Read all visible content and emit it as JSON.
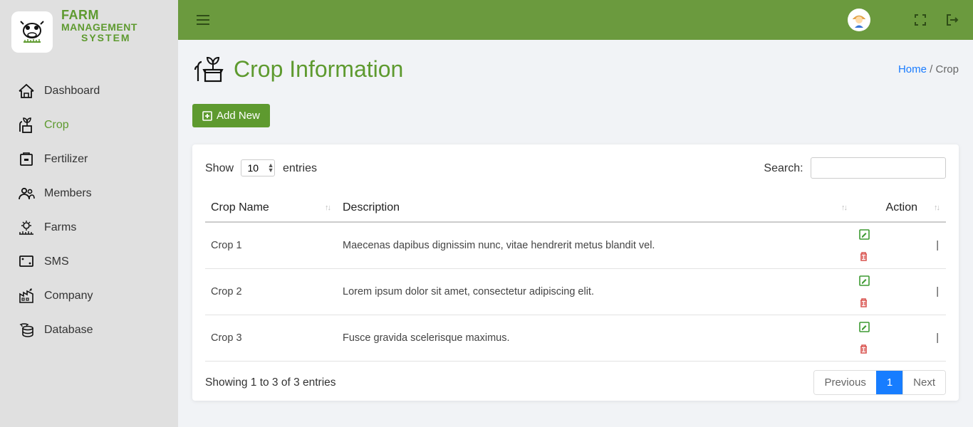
{
  "brand": {
    "line1": "FARM",
    "line2": "MANAGEMENT",
    "line3": "SYSTEM"
  },
  "sidebar": {
    "items": [
      {
        "label": "Dashboard",
        "active": false
      },
      {
        "label": "Crop",
        "active": true
      },
      {
        "label": "Fertilizer",
        "active": false
      },
      {
        "label": "Members",
        "active": false
      },
      {
        "label": "Farms",
        "active": false
      },
      {
        "label": "SMS",
        "active": false
      },
      {
        "label": "Company",
        "active": false
      },
      {
        "label": "Database",
        "active": false
      }
    ]
  },
  "page": {
    "title": "Crop Information",
    "breadcrumb_home": "Home",
    "breadcrumb_sep": " / ",
    "breadcrumb_current": "Crop"
  },
  "buttons": {
    "add_new": "Add New"
  },
  "datatable": {
    "show_label": "Show",
    "entries_label": "entries",
    "entries_value": "10",
    "search_label": "Search:",
    "columns": {
      "c1": "Crop Name",
      "c2": "Description",
      "c3": "Action"
    },
    "rows": [
      {
        "name": "Crop 1",
        "desc": "Maecenas dapibus dignissim nunc, vitae hendrerit metus blandit vel."
      },
      {
        "name": "Crop 2",
        "desc": "Lorem ipsum dolor sit amet, consectetur adipiscing elit."
      },
      {
        "name": "Crop 3",
        "desc": "Fusce gravida scelerisque maximus."
      }
    ],
    "info": "Showing 1 to 3 of 3 entries",
    "prev": "Previous",
    "page1": "1",
    "next": "Next"
  }
}
